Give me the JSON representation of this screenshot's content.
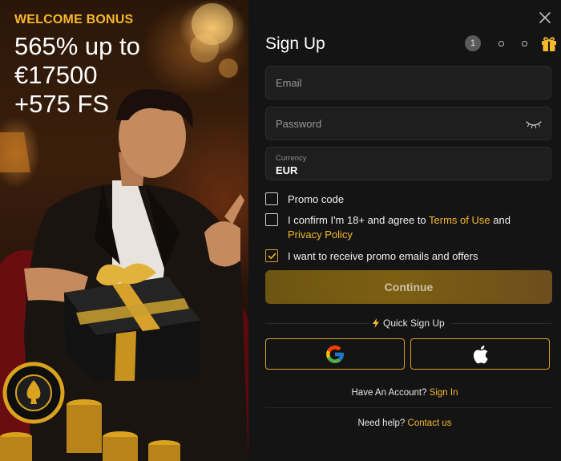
{
  "promo": {
    "label": "WELCOME BONUS",
    "amount_lines": [
      "565% up to",
      "€17500",
      "+575 FS"
    ]
  },
  "form": {
    "title": "Sign Up",
    "steps": {
      "current": "1",
      "total": 3
    },
    "email_placeholder": "Email",
    "password_placeholder": "Password",
    "currency_label": "Currency",
    "currency_value": "EUR",
    "promo_code_label": "Promo code",
    "terms_prefix": "I confirm I'm 18+ and agree to ",
    "terms_link": "Terms of Use",
    "terms_and": " and ",
    "privacy_link": "Privacy Policy",
    "emails_label": "I want to receive promo emails and offers",
    "emails_checked": true,
    "promo_checked": false,
    "terms_checked": false,
    "continue_label": "Continue",
    "quick_signup_label": "Quick Sign Up",
    "account_prefix": "Have An Account?",
    "sign_in_link": "Sign In",
    "help_prefix": "Need help?",
    "contact_link": "Contact us"
  },
  "icons": {
    "close": "close-icon",
    "gift": "gift-icon",
    "eye": "eye-closed-icon",
    "bolt": "lightning-icon",
    "google": "google-icon",
    "apple": "apple-icon"
  },
  "colors": {
    "accent": "#f5b82e",
    "panel_bg": "#141414",
    "field_bg": "#1e1e1e",
    "continue_bg": "#7d5f12"
  }
}
